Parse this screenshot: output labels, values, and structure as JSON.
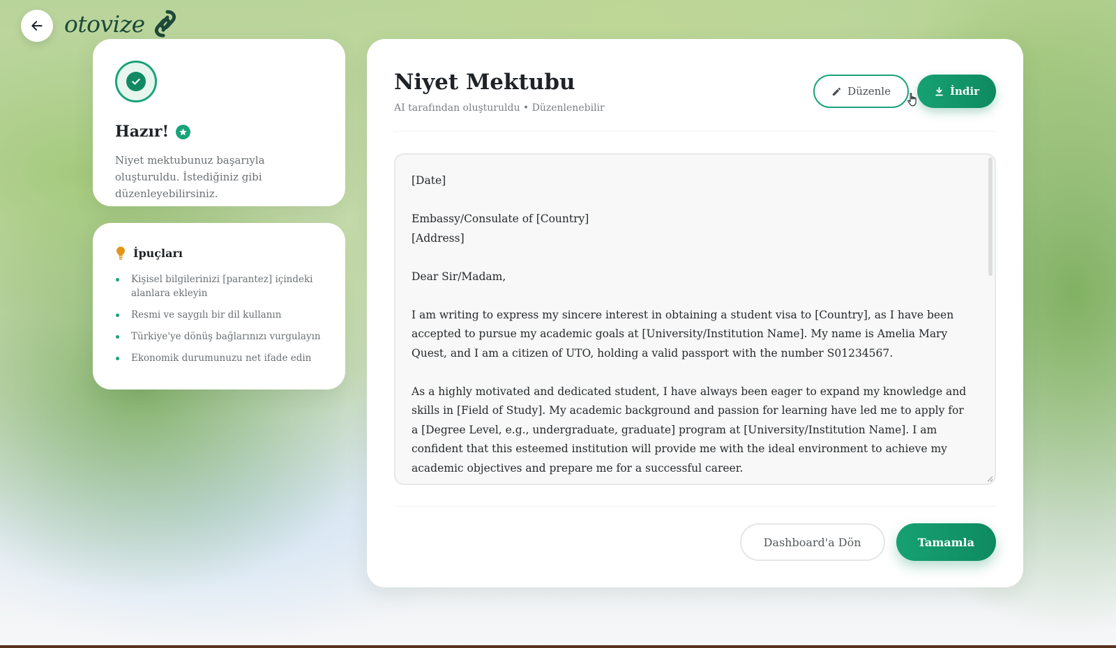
{
  "header": {
    "back_icon": "arrow-left-icon",
    "logo_text": "otovize",
    "logo_icon": "leaf-link-icon"
  },
  "status_card": {
    "icon": "check-circle-icon",
    "title": "Hazır!",
    "badge_icon": "star-badge-icon",
    "description": "Niyet mektubunuz başarıyla oluşturuldu. İstediğiniz gibi düzenleyebilirsiniz."
  },
  "tips": {
    "icon": "lightbulb-icon",
    "title": "İpuçları",
    "items": [
      "Kişisel bilgilerinizi [parantez] içindeki alanlara ekleyin",
      "Resmi ve saygılı bir dil kullanın",
      "Türkiye'ye dönüş bağlarınızı vurgulayın",
      "Ekonomik durumunuzu net ifade edin"
    ]
  },
  "document": {
    "title": "Niyet Mektubu",
    "subtitle": "AI tarafından oluşturuldu • Düzenlenebilir",
    "edit_label": "Düzenle",
    "download_label": "İndir",
    "content": "[Date]\n\nEmbassy/Consulate of [Country]\n[Address]\n\nDear Sir/Madam,\n\nI am writing to express my sincere interest in obtaining a student visa to [Country], as I have been accepted to pursue my academic goals at [University/Institution Name]. My name is Amelia Mary Quest, and I am a citizen of UTO, holding a valid passport with the number S01234567.\n\nAs a highly motivated and dedicated student, I have always been eager to expand my knowledge and skills in [Field of Study]. My academic background and passion for learning have led me to apply for a [Degree Level, e.g., undergraduate, graduate] program at [University/Institution Name]. I am confident that this esteemed institution will provide me with the ideal environment to achieve my academic objectives and prepare me for a successful career.\n\nI would like to emphasize that my intention to study in [Country] is genuine and well-researched. I have thoroughly"
  },
  "footer": {
    "back_label": "Dashboard'a Dön",
    "complete_label": "Tamamla"
  },
  "colors": {
    "accent": "#1aa37a",
    "accent_dark": "#0f8a60",
    "tip_icon": "#e3941b"
  }
}
